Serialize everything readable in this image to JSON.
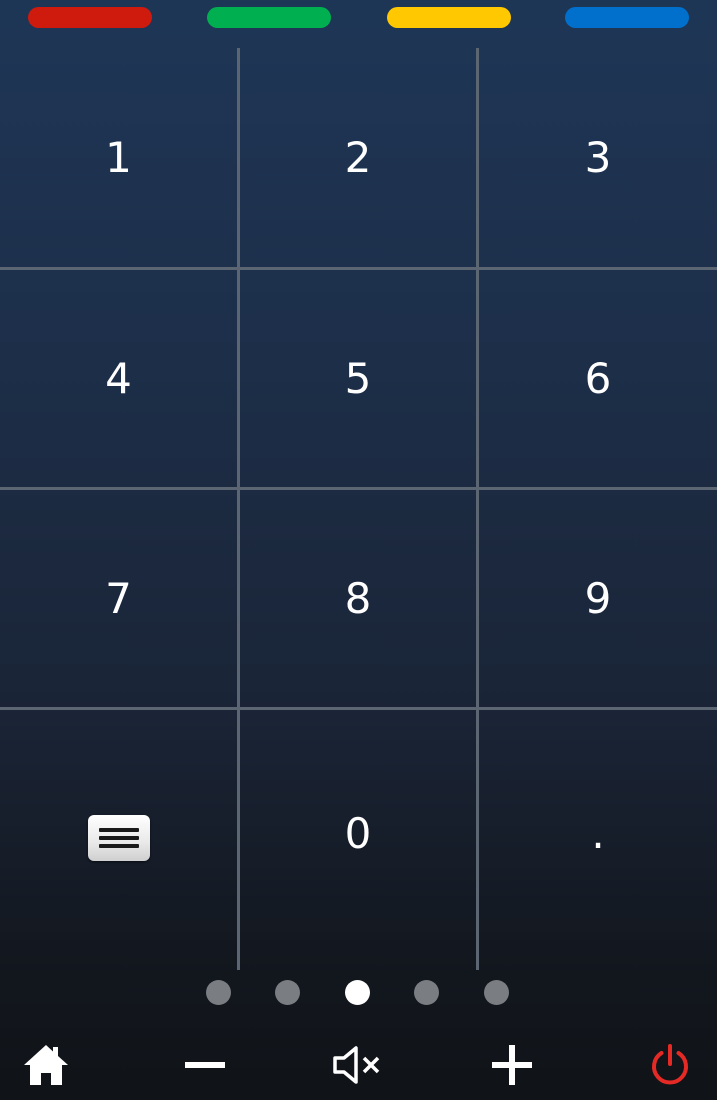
{
  "color_buttons": [
    {
      "name": "red",
      "color": "#cf1a0e"
    },
    {
      "name": "green",
      "color": "#00b050"
    },
    {
      "name": "yellow",
      "color": "#ffc800"
    },
    {
      "name": "blue",
      "color": "#0070cc"
    }
  ],
  "keypad": {
    "k1": "1",
    "k2": "2",
    "k3": "3",
    "k4": "4",
    "k5": "5",
    "k6": "6",
    "k7": "7",
    "k8": "8",
    "k9": "9",
    "k0": "0",
    "dot": ".",
    "menu_icon": "menu-icon"
  },
  "page_indicator": {
    "count": 5,
    "active_page": 3
  },
  "bottom_bar": {
    "icons": [
      "home-icon",
      "volume-down-icon",
      "mute-icon",
      "volume-up-icon",
      "power-icon"
    ],
    "power_color": "#e52a25"
  }
}
